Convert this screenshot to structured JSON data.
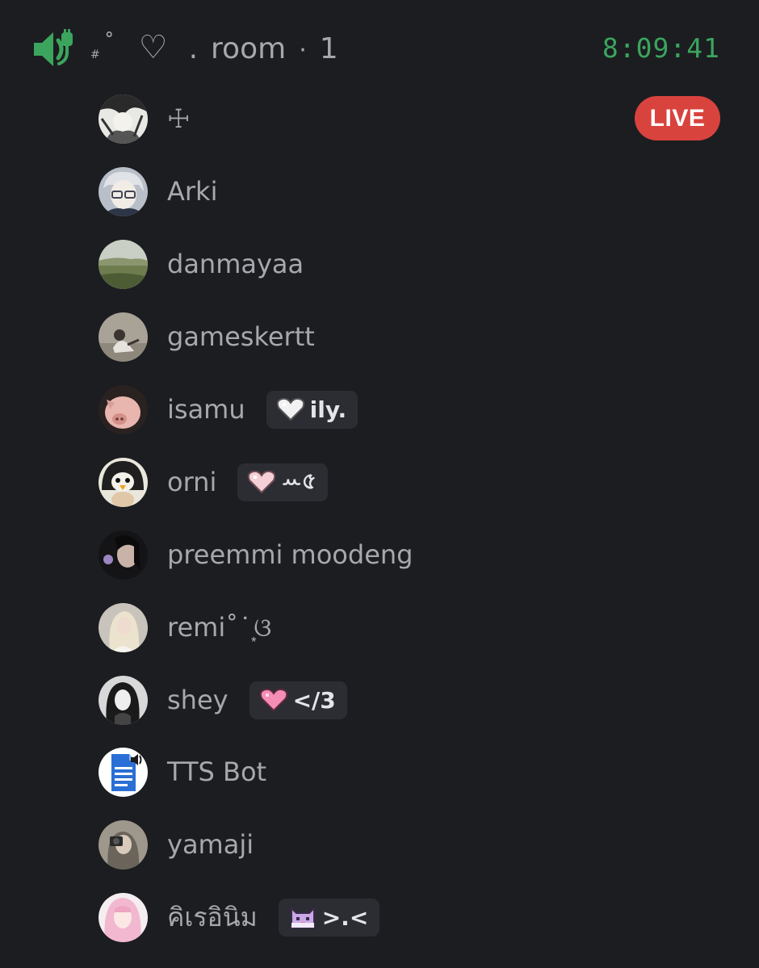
{
  "header": {
    "channel_prefix": "#",
    "channel_deg": "˚",
    "channel_heart": "♡",
    "channel_dot": ".",
    "channel_name": "room",
    "separator": "·",
    "user_count": "1",
    "timer": "8:09:41",
    "live_label": "LIVE",
    "accent_green": "#3ba55d",
    "live_red": "#d9433e"
  },
  "users": [
    {
      "name": "☩",
      "avatar": "avatar-manga-character"
    },
    {
      "name": "Arki",
      "avatar": "avatar-anime-glasses"
    },
    {
      "name": "danmayaa",
      "avatar": "avatar-landscape"
    },
    {
      "name": "gameskertt",
      "avatar": "avatar-person-sitting"
    },
    {
      "name": "isamu",
      "avatar": "avatar-pig",
      "status_icon": "white-heart-icon",
      "status_text": "ily."
    },
    {
      "name": "orni",
      "avatar": "avatar-penguin",
      "status_icon": "pink-heart-icon",
      "status_text": "ꕀ৫"
    },
    {
      "name": "preemmi moodeng",
      "avatar": "avatar-dark-portrait"
    },
    {
      "name": "remi˚ ͘ ͙ଓ",
      "avatar": "avatar-blonde"
    },
    {
      "name": "shey",
      "avatar": "avatar-bw-portrait",
      "status_icon": "pink-heart-icon",
      "status_text": "</3"
    },
    {
      "name": "TTS Bot",
      "avatar": "avatar-tts-document"
    },
    {
      "name": "yamaji",
      "avatar": "avatar-camera-selfie"
    },
    {
      "name": "คิเรอินิม",
      "avatar": "avatar-pink-hair",
      "status_icon": "pixel-cat-icon",
      "status_text": ">.<"
    }
  ]
}
